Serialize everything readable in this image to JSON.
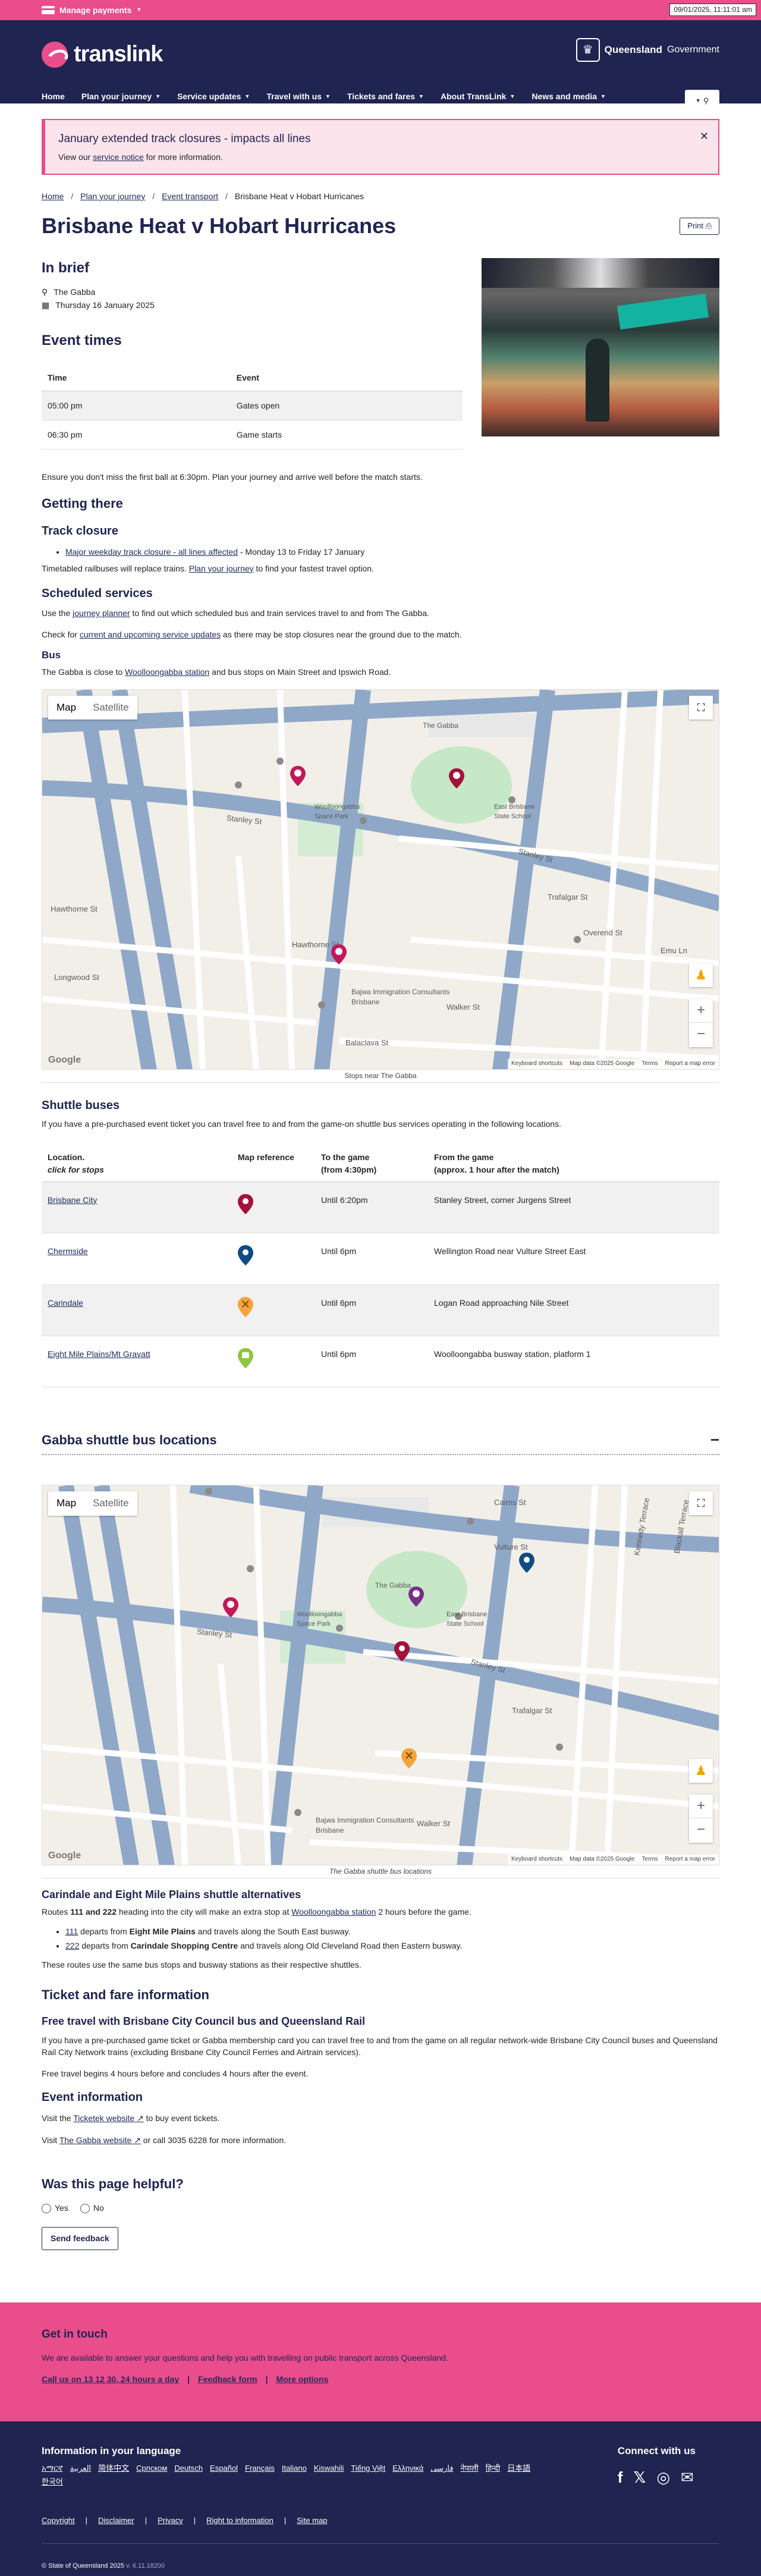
{
  "clock": "09/01/2025, 11:11:01 am",
  "topbar": {
    "manage_label": "Manage payments"
  },
  "header": {
    "logo": "translink",
    "gov_bold": "Queensland",
    "gov_rest": "Government",
    "nav": [
      "Home",
      "Plan your journey",
      "Service updates",
      "Travel with us",
      "Tickets and fares",
      "About TransLink",
      "News and media"
    ]
  },
  "alert": {
    "title": "January extended track closures - impacts all lines",
    "text_a": "View our ",
    "link": "service notice",
    "text_b": " for more information."
  },
  "breadcrumb": [
    "Home",
    "Plan your journey",
    "Event transport",
    "Brisbane Heat v Hobart Hurricanes"
  ],
  "page": {
    "title": "Brisbane Heat v Hobart Hurricanes",
    "print": "Print",
    "brief_heading": "In brief",
    "venue": "The Gabba",
    "date": "Thursday 16 January 2025",
    "event_times_heading": "Event times",
    "table_headers": [
      "Time",
      "Event"
    ],
    "events": [
      {
        "time": "05:00 pm",
        "event": "Gates open"
      },
      {
        "time": "06:30 pm",
        "event": "Game starts"
      }
    ],
    "ensure": "Ensure you don't miss the first ball at 6:30pm. Plan your journey and arrive well before the match starts.",
    "getting_there": "Getting there",
    "track_closure": "Track closure",
    "closure_link": "Major weekday track closure - all lines affected",
    "closure_dates": " - Monday 13 to Friday 17 January",
    "railbus_a": "Timetabled railbuses will replace trains. ",
    "railbus_link": "Plan your journey",
    "railbus_b": " to find your fastest travel option.",
    "scheduled": "Scheduled services",
    "use_a": "Use the ",
    "use_link": "journey planner",
    "use_b": " to find out which scheduled bus and train services travel to and from The Gabba.",
    "check_a": "Check for ",
    "check_link": "current and upcoming service updates",
    "check_b": " as there may be stop closures near the ground due to the match.",
    "bus": "Bus",
    "bus_a": "The Gabba is close to ",
    "bus_link": "Woolloongabba station",
    "bus_b": " and bus stops on Main Street and Ipswich Road.",
    "map1_caption": "Stops near The Gabba",
    "shuttle_heading": "Shuttle buses",
    "shuttle_text": "If you have a pre-purchased event ticket you can travel free to and from the game-on shuttle bus services operating in the following locations.",
    "shuttle_headers": {
      "location": "Location.",
      "location_sub": "click for stops",
      "mapref": "Map reference",
      "to": "To the game",
      "to_sub": "(from 4:30pm)",
      "from": "From the game",
      "from_sub": "(approx. 1 hour after the match)"
    },
    "shuttles": [
      {
        "location": "Brisbane City",
        "until": "Until 6:20pm",
        "from": "Stanley Street, corner Jurgens Street",
        "color": "#a3123a"
      },
      {
        "location": "Chermside",
        "until": "Until 6pm",
        "from": "Wellington Road near Vulture Street East",
        "color": "#0f4c81"
      },
      {
        "location": "Carindale",
        "until": "Until 6pm",
        "from": "Logan Road approaching Nile Street",
        "color": "#f5a33b"
      },
      {
        "location": "Eight Mile Plains/Mt Gravatt",
        "until": "Until 6pm",
        "from": "Woolloongabba busway station, platform 1",
        "color": "#8dc63f"
      }
    ],
    "shuttle_map_heading": "Gabba shuttle bus locations",
    "map2_caption": "The Gabba shuttle bus locations",
    "alt_heading": "Carindale and Eight Mile Plains shuttle alternatives",
    "alt_a": "Routes ",
    "alt_routes": "111 and 222",
    "alt_b": " heading into the city will make an extra stop at ",
    "alt_link": "Woolloongabba station",
    "alt_c": " 2 hours before the game.",
    "alt_items": [
      {
        "route": "111",
        "a": " departs from ",
        "place": "Eight Mile Plains",
        "b": " and travels along the South East busway."
      },
      {
        "route": "222",
        "a": " departs from ",
        "place": "Carindale Shopping Centre",
        "b": " and travels along Old Cleveland Road then Eastern busway."
      }
    ],
    "alt_note": "These routes use the same bus stops and busway stations as their respective shuttles.",
    "ticket_heading": "Ticket and fare information",
    "free_heading": "Free travel with Brisbane City Council bus and Queensland Rail",
    "free_text": "If you have a pre-purchased game ticket or Gabba membership card you can travel free to and from the game on all regular network-wide Brisbane City Council buses and Queensland Rail City Network trains (excluding Brisbane City Council Ferries and Airtrain services).",
    "free_time": "Free travel begins 4 hours before and concludes 4 hours after the event.",
    "event_info": "Event information",
    "visit_a": "Visit the ",
    "visit_link": "Ticketek website",
    "visit_b": " to buy event tickets.",
    "visit2_a": "Visit ",
    "visit2_link": "The Gabba website",
    "visit2_b": " or call 3035 6228 for more information.",
    "helpful": "Was this page helpful?",
    "yes": "Yes",
    "no": "No",
    "send": "Send feedback"
  },
  "map": {
    "map_btn": "Map",
    "sat_btn": "Satellite",
    "google": "Google",
    "shortcuts": "Keyboard shortcuts",
    "mapdata": "Map data ©2025 Google",
    "terms": "Terms",
    "report": "Report a map error",
    "labels": {
      "gabba": "The Gabba",
      "park": "Woolloongabba Space Park",
      "school": "East Brisbane State School",
      "stanley": "Stanley St",
      "hawthorne": "Hawthorne St",
      "trafalgar": "Trafalgar St",
      "overend": "Overend St",
      "emu": "Emu Ln",
      "walker": "Walker St",
      "balaclava": "Balaclava St",
      "bajwa": "Bajwa Immigration Consultants Brisbane",
      "longwood": "Longwood St",
      "cairns": "Cairns St",
      "vulture": "Vulture St",
      "kennedy": "Kennedy Terrace",
      "blackall": "Blackall Terrace"
    }
  },
  "touch": {
    "heading": "Get in touch",
    "text": "We are available to answer your questions and help you with travelling on public transport across Queensland.",
    "call": "Call us on 13 12 30, 24 hours a day",
    "feedback": "Feedback form",
    "more": "More options"
  },
  "footer": {
    "lang_heading": "Information in your language",
    "langs": [
      "አማርኛ",
      "العربية",
      "简体中文",
      "Српском",
      "Deutsch",
      "Español",
      "Français",
      "Italiano",
      "Kiswahili",
      "Tiếng Việt",
      "Ελληνικά",
      "فارسی",
      "नेपाली",
      "हिन्दी",
      "日本語",
      "한국어"
    ],
    "connect": "Connect with us",
    "links": [
      "Copyright",
      "Disclaimer",
      "Privacy",
      "Right to information",
      "Site map"
    ],
    "copyright": "© State of Queensland 2025",
    "version": "v. 6.11.18200"
  }
}
